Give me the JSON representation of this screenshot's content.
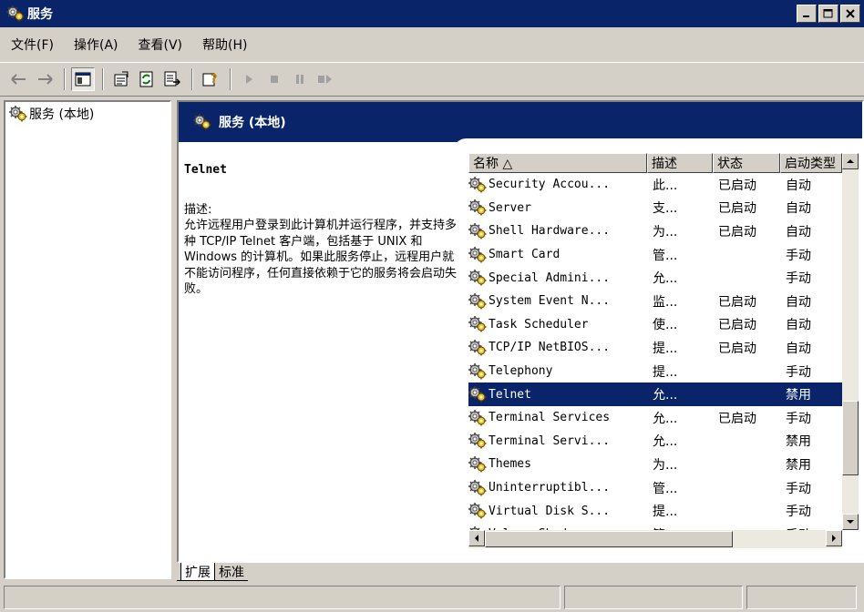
{
  "window": {
    "title": "服务"
  },
  "menu": [
    {
      "label": "文件(F)"
    },
    {
      "label": "操作(A)"
    },
    {
      "label": "查看(V)"
    },
    {
      "label": "帮助(H)"
    }
  ],
  "toolbar": {
    "icons": [
      "back-arrow-icon",
      "forward-arrow-icon",
      "show-hide-tree-icon",
      "properties-icon",
      "refresh-icon",
      "export-list-icon",
      "help-icon",
      "start-service-icon",
      "stop-service-icon",
      "pause-service-icon",
      "restart-service-icon"
    ]
  },
  "tree": {
    "root_label": "服务 (本地)"
  },
  "banner": {
    "title": "服务 (本地)"
  },
  "description": {
    "service_name": "Telnet",
    "label": "描述:",
    "text": "允许远程用户登录到此计算机并运行程序，并支持多种 TCP/IP Telnet 客户端，包括基于 UNIX 和 Windows 的计算机。如果此服务停止，远程用户就不能访问程序，任何直接依赖于它的服务将会启动失败。"
  },
  "list": {
    "columns": [
      "名称 △",
      "描述",
      "状态",
      "启动类型"
    ],
    "rows": [
      {
        "name": "Security Accou...",
        "desc": "此...",
        "status": "已启动",
        "startup": "自动"
      },
      {
        "name": "Server",
        "desc": "支...",
        "status": "已启动",
        "startup": "自动"
      },
      {
        "name": "Shell Hardware...",
        "desc": "为...",
        "status": "已启动",
        "startup": "自动"
      },
      {
        "name": "Smart Card",
        "desc": "管...",
        "status": "",
        "startup": "手动"
      },
      {
        "name": "Special Admini...",
        "desc": "允...",
        "status": "",
        "startup": "手动"
      },
      {
        "name": "System Event N...",
        "desc": "监...",
        "status": "已启动",
        "startup": "自动"
      },
      {
        "name": "Task Scheduler",
        "desc": "使...",
        "status": "已启动",
        "startup": "自动"
      },
      {
        "name": "TCP/IP NetBIOS...",
        "desc": "提...",
        "status": "已启动",
        "startup": "自动"
      },
      {
        "name": "Telephony",
        "desc": "提...",
        "status": "",
        "startup": "手动"
      },
      {
        "name": "Telnet",
        "desc": "允...",
        "status": "",
        "startup": "禁用",
        "selected": true
      },
      {
        "name": "Terminal Services",
        "desc": "允...",
        "status": "已启动",
        "startup": "手动"
      },
      {
        "name": "Terminal Servi...",
        "desc": "允...",
        "status": "",
        "startup": "禁用"
      },
      {
        "name": "Themes",
        "desc": "为...",
        "status": "",
        "startup": "禁用"
      },
      {
        "name": "Uninterruptibl...",
        "desc": "管...",
        "status": "",
        "startup": "手动"
      },
      {
        "name": "Virtual Disk S...",
        "desc": "提...",
        "status": "",
        "startup": "手动"
      },
      {
        "name": "Volume Shadow ...",
        "desc": "管...",
        "status": "",
        "startup": "手动"
      }
    ]
  },
  "tabs": [
    {
      "label": "扩展",
      "active": true
    },
    {
      "label": "标准",
      "active": false
    }
  ],
  "colors": {
    "titlebar": "#0a246a",
    "selection": "#0a246a",
    "face": "#d4d0c8"
  }
}
